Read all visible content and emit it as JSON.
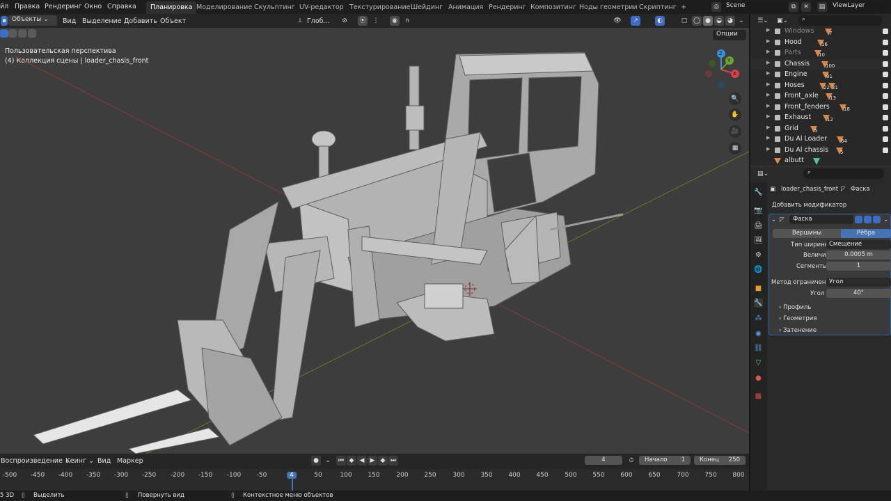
{
  "menu": {
    "file": "йл",
    "edit": "Правка",
    "render": "Рендеринг",
    "window": "Окно",
    "help": "Справка"
  },
  "workspaces": [
    "Планировка",
    "Моделирование",
    "Скульптинг",
    "UV-редактор",
    "Текстурирование",
    "Шейдинг",
    "Анимация",
    "Рендеринг",
    "Композитинг",
    "Ноды геометрии",
    "Скриптинг",
    "+"
  ],
  "scene": "Scene",
  "view_layer": "ViewLayer",
  "header": {
    "mode": "Объекты",
    "view": "Вид",
    "select": "Выделение",
    "add": "Добавить",
    "object": "Объект",
    "orientation": "Глоб...",
    "options": "Опции"
  },
  "viewport": {
    "perspective": "Пользовательская перспектива",
    "collection": "(4) Коллекция сцены | loader_chasis_front"
  },
  "gizmo": {
    "x": "X",
    "y": "Y",
    "z": "Z"
  },
  "outliner": {
    "rows": [
      {
        "name": "Windows",
        "count": "7",
        "dim": true
      },
      {
        "name": "Hood",
        "count": "16"
      },
      {
        "name": "Parts",
        "count": "10",
        "dim": true
      },
      {
        "name": "Chassis",
        "count": "100"
      },
      {
        "name": "Engine",
        "count": "81"
      },
      {
        "name": "Hoses",
        "count": "22",
        "count2": "31"
      },
      {
        "name": "Front_axle",
        "count": "13"
      },
      {
        "name": "Front_fenders",
        "count": "18"
      },
      {
        "name": "Exhaust",
        "count": "12"
      },
      {
        "name": "Grid",
        "count": "5"
      },
      {
        "name": "Du Al Loader",
        "count": "64"
      },
      {
        "name": "Du Al chassis",
        "count": "5"
      },
      {
        "name": "albutt",
        "count": ""
      }
    ]
  },
  "properties": {
    "object": "loader_chasis_front",
    "modifier_crumb": "Фаска",
    "add_modifier": "Добавить модификатор",
    "modifier_name": "Фаска",
    "vertices": "Вершины",
    "edges": "Рёбра",
    "width_type_label": "Тип ширины",
    "width_type": "Смещение",
    "amount_label": "Величина",
    "amount": "0.0005 m",
    "segments_label": "Сегменты",
    "segments": "1",
    "limit_label": "Метод ограничения",
    "limit": "Угол",
    "angle_label": "Угол",
    "angle": "40°",
    "profile": "Профиль",
    "geometry": "Геометрия",
    "shading": "Затенение"
  },
  "timeline": {
    "playback": "Воспроизведение",
    "keying": "Кеинг",
    "view": "Вид",
    "marker": "Маркер",
    "current": "4",
    "start_label": "Начало",
    "start": "1",
    "end_label": "Конец",
    "end": "250",
    "ticks": [
      "-500",
      "-450",
      "-400",
      "-350",
      "-300",
      "-250",
      "-200",
      "-150",
      "-100",
      "-50",
      "4",
      "50",
      "100",
      "150",
      "200",
      "250",
      "300",
      "350",
      "400",
      "450",
      "500",
      "550",
      "600",
      "650",
      "700",
      "750",
      "800"
    ]
  },
  "status": {
    "version": "5 3D",
    "select": "Выделить",
    "rotate": "Повернуть вид",
    "context": "Контекстное меню объектов"
  }
}
